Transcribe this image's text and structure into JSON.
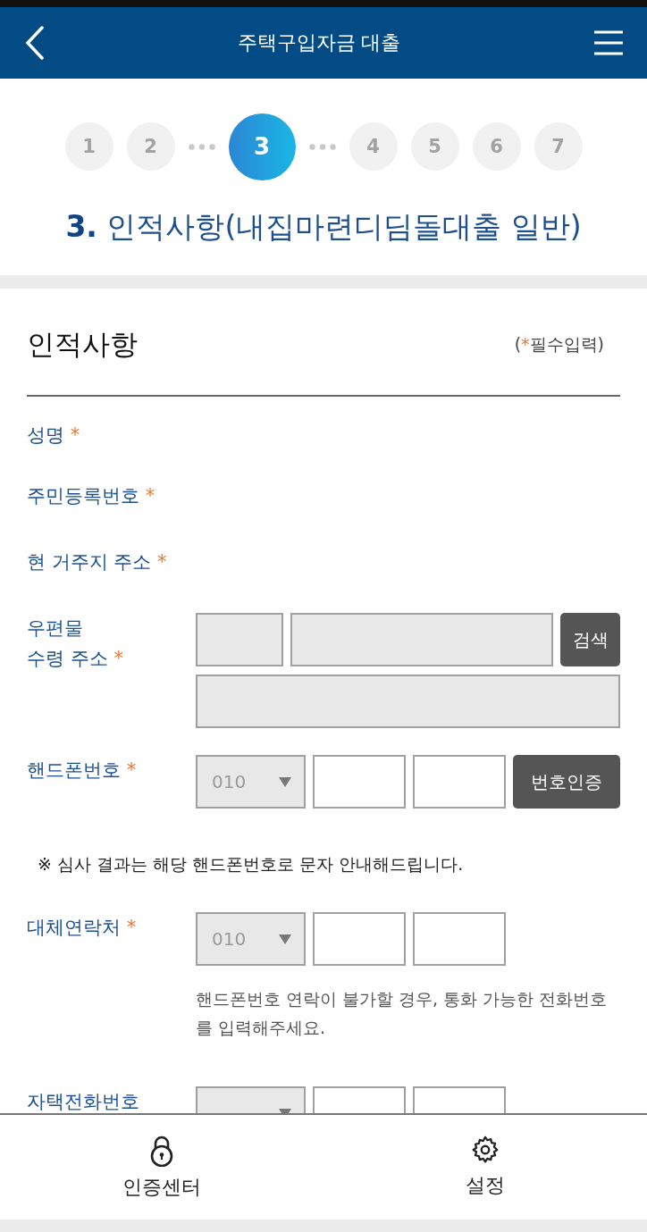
{
  "header": {
    "title": "주택구입자금 대출"
  },
  "steps": [
    {
      "label": "1",
      "selected": false
    },
    {
      "label": "2",
      "selected": false,
      "dots_after": true
    },
    {
      "label": "3",
      "selected": true,
      "dots_after": true
    },
    {
      "label": "4",
      "selected": false
    },
    {
      "label": "5",
      "selected": false
    },
    {
      "label": "6",
      "selected": false
    },
    {
      "label": "7",
      "selected": false
    }
  ],
  "heading": {
    "number": "3.",
    "text": "인적사항(내집마련디딤돌대출 일반)"
  },
  "section": {
    "title": "인적사항",
    "note_parts": [
      "(",
      "*",
      "필수입력)"
    ]
  },
  "rows": [
    {
      "kind": "plain",
      "label": [
        "성명"
      ],
      "mark": "*"
    },
    {
      "kind": "plain",
      "label": [
        "주민등록번호"
      ],
      "mark": "*"
    },
    {
      "kind": "plain",
      "label": [
        "현 거주지 주소"
      ],
      "mark": "*"
    },
    {
      "kind": "address",
      "label": [
        "우편물",
        "수령 주소"
      ],
      "mark": "*",
      "button": "검색"
    },
    {
      "kind": "phone",
      "label": [
        "핸드폰번호"
      ],
      "mark": "*",
      "prefix": "010",
      "button": "번호인증"
    },
    {
      "kind": "notice",
      "text": "※ 심사 결과는 해당 핸드폰번호로 문자 안내해드립니다."
    },
    {
      "kind": "phone",
      "label": [
        "대체연락처"
      ],
      "mark": "*",
      "prefix": "010",
      "help": "핸드폰번호 연락이 불가할 경우, 통화 가능한 전화번호를 입력해주세요."
    },
    {
      "kind": "phone",
      "label": [
        "자택전화번호"
      ]
    }
  ],
  "tabbar": [
    {
      "kind": "lock",
      "label": "인증센터"
    },
    {
      "kind": "gear",
      "label": "설정"
    }
  ]
}
